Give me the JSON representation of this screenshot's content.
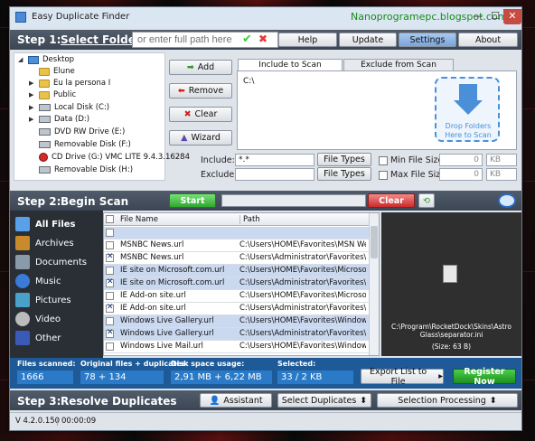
{
  "window": {
    "title": "Easy Duplicate Finder",
    "blog": "Nanoprogramepc.blogspot.com",
    "buttons": {
      "minimize": "—",
      "maximize": "☐",
      "close": "✕"
    }
  },
  "step1": {
    "prefix": "Step 1:",
    "label": "Select Folders",
    "path_placeholder": "or enter full path here",
    "menu": [
      "Help",
      "Update",
      "Settings",
      "About"
    ],
    "actions": [
      "Add",
      "Remove",
      "Clear",
      "Wizard"
    ],
    "tree": [
      {
        "label": "Desktop",
        "icon": "desktop-icon"
      },
      {
        "label": "Elune",
        "icon": "folder-icon"
      },
      {
        "label": "Eu la persona I",
        "icon": "folder-icon"
      },
      {
        "label": "Public",
        "icon": "folder-icon"
      },
      {
        "label": "Local Disk (C:)",
        "icon": "drive-icon"
      },
      {
        "label": "Data (D:)",
        "icon": "drive-icon"
      },
      {
        "label": "DVD RW Drive (E:)",
        "icon": "drive-icon"
      },
      {
        "label": "Removable Disk (F:)",
        "icon": "drive-icon"
      },
      {
        "label": "CD Drive (G:) VMC LITE 9.4.3.16284",
        "icon": "cd-icon"
      },
      {
        "label": "Removable Disk (H:)",
        "icon": "drive-icon"
      }
    ],
    "tabs": [
      "Include to Scan",
      "Exclude from Scan"
    ],
    "scan_path": "C:\\",
    "drop_text": "Drop Folders Here to Scan",
    "include_label": "Include:",
    "include_value": "*.*",
    "exclude_label": "Exclude:",
    "filetypes_label": "File Types",
    "min_label": "Min File Size",
    "max_label": "Max File Size",
    "size_value": "0",
    "unit": "KB"
  },
  "step2": {
    "prefix": "Step 2:",
    "label": "Begin Scan",
    "start": "Start",
    "clear": "Clear",
    "categories": [
      "All Files",
      "Archives",
      "Documents",
      "Music",
      "Pictures",
      "Video",
      "Other"
    ],
    "columns": [
      "File Name",
      "Path"
    ],
    "rows": [
      {
        "name": "",
        "path": "",
        "checked": false,
        "hl": true
      },
      {
        "name": "MSNBC News.url",
        "path": "C:\\Users\\HOME\\Favorites\\MSN Websites",
        "checked": false,
        "hl": false
      },
      {
        "name": "MSNBC News.url",
        "path": "C:\\Users\\Administrator\\Favorites\\MSN W",
        "checked": true,
        "hl": false
      },
      {
        "name": "IE site on Microsoft.com.url",
        "path": "C:\\Users\\HOME\\Favorites\\Microsoft Web",
        "checked": false,
        "hl": true
      },
      {
        "name": "IE site on Microsoft.com.url",
        "path": "C:\\Users\\Administrator\\Favorites\\Micros",
        "checked": true,
        "hl": true
      },
      {
        "name": "IE Add-on site.url",
        "path": "C:\\Users\\HOME\\Favorites\\Microsoft Web",
        "checked": false,
        "hl": false
      },
      {
        "name": "IE Add-on site.url",
        "path": "C:\\Users\\Administrator\\Favorites\\Micros",
        "checked": true,
        "hl": false
      },
      {
        "name": "Windows Live Gallery.url",
        "path": "C:\\Users\\HOME\\Favorites\\Windows Live",
        "checked": false,
        "hl": true
      },
      {
        "name": "Windows Live Gallery.url",
        "path": "C:\\Users\\Administrator\\Favorites\\Windo",
        "checked": true,
        "hl": true
      },
      {
        "name": "Windows Live Mail.url",
        "path": "C:\\Users\\HOME\\Favorites\\Windows Live",
        "checked": false,
        "hl": false
      }
    ],
    "preview_path": "C:\\Program\\RocketDock\\Skins\\Astro Glass\\separator.ini",
    "preview_size": "(Size: 63 B)"
  },
  "stats": {
    "scanned_label": "Files scanned:",
    "scanned": "1666",
    "original_label": "Original files + duplicates:",
    "original": "78 + 134",
    "disk_label": "Disk space usage:",
    "disk": "2,91 MB + 6,22 MB",
    "selected_label": "Selected:",
    "selected": "33 / 2 KB",
    "export": "Export List to File",
    "register": "Register Now"
  },
  "step3": {
    "prefix": "Step 3:",
    "label": "Resolve Duplicates",
    "assistant": "Assistant",
    "select_dup": "Select Duplicates",
    "sel_proc": "Selection Processing"
  },
  "status": {
    "version": "V 4.2.0.150",
    "time": "00:00:09"
  }
}
